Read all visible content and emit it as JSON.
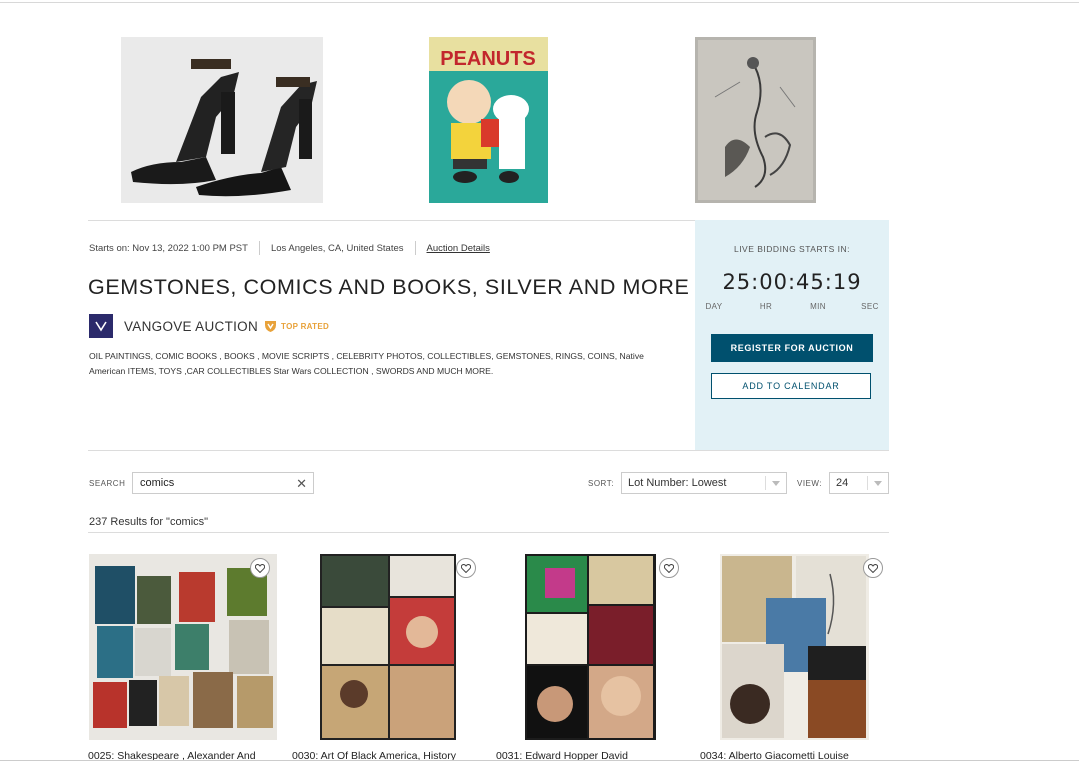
{
  "auction": {
    "starts_on": "Starts on: Nov 13, 2022 1:00 PM PST",
    "location": "Los Angeles, CA, United States",
    "details_link": "Auction Details",
    "title": "GEMSTONES, COMICS AND BOOKS, SILVER AND MORE",
    "seller_name": "VANGOVE AUCTION",
    "seller_badge": "TOP RATED",
    "description": "OIL PAINTINGS, COMIC BOOKS , BOOKS , MOVIE SCRIPTS , CELEBRITY PHOTOS, COLLECTIBLES, GEMSTONES, RINGS, COINS, Native American ITEMS, TOYS ,CAR COLLECTIBLES Star Wars COLLECTION , SWORDS AND MUCH MORE."
  },
  "hero_images": [
    {
      "icon": "black-sandals-image"
    },
    {
      "icon": "peanuts-comic-cover-image",
      "text": "PEANUTS"
    },
    {
      "icon": "sketch-drawing-image"
    }
  ],
  "live": {
    "label": "LIVE BIDDING STARTS IN:",
    "countdown": "25:00:45:19",
    "units": [
      "DAY",
      "HR",
      "MIN",
      "SEC"
    ],
    "register_label": "REGISTER FOR AUCTION",
    "calendar_label": "ADD TO CALENDAR"
  },
  "filters": {
    "search_label": "SEARCH",
    "search_value": "comics",
    "sort_label": "SORT:",
    "sort_value": "Lot Number: Lowest",
    "view_label": "VIEW:",
    "view_value": "24"
  },
  "results": {
    "count_text": "237 Results for \"comics\"",
    "lots": [
      {
        "title": "0025: Shakespeare , Alexander And"
      },
      {
        "title": "0030: Art Of Black America, History"
      },
      {
        "title": "0031: Edward Hopper David"
      },
      {
        "title": "0034: Alberto Giacometti Louise"
      }
    ]
  },
  "colors": {
    "primary": "#00506e",
    "panel_bg": "#e2f1f6",
    "badge": "#e8a23a",
    "seller_logo_bg": "#2b2a6b"
  }
}
